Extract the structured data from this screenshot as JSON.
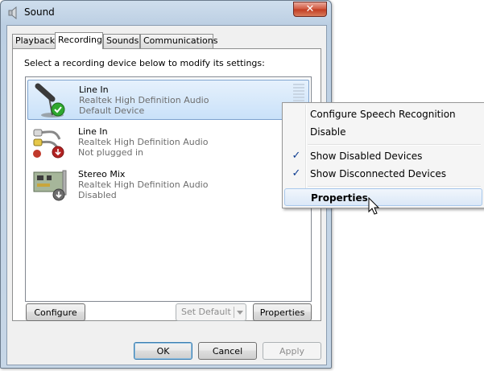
{
  "window": {
    "title": "Sound",
    "close_label": "✕"
  },
  "tabs": [
    {
      "label": "Playback"
    },
    {
      "label": "Recording"
    },
    {
      "label": "Sounds"
    },
    {
      "label": "Communications"
    }
  ],
  "active_tab": "Recording",
  "instruction": "Select a recording device below to modify its settings:",
  "devices": [
    {
      "name": "Line In",
      "driver": "Realtek High Definition Audio",
      "status": "Default Device",
      "icon": "microphone-icon",
      "badge": "green-check-badge"
    },
    {
      "name": "Line In",
      "driver": "Realtek High Definition Audio",
      "status": "Not plugged in",
      "icon": "rca-cable-icon",
      "badge": "red-down-arrow-badge"
    },
    {
      "name": "Stereo Mix",
      "driver": "Realtek High Definition Audio",
      "status": "Disabled",
      "icon": "sound-card-icon",
      "badge": "grey-down-arrow-badge"
    }
  ],
  "buttons": {
    "configure": "Configure",
    "set_default": "Set Default",
    "properties": "Properties",
    "ok": "OK",
    "cancel": "Cancel",
    "apply": "Apply"
  },
  "context_menu": {
    "items": [
      {
        "label": "Configure Speech Recognition",
        "checked": false
      },
      {
        "label": "Disable",
        "checked": false
      },
      {
        "label": "Show Disabled Devices",
        "checked": true
      },
      {
        "label": "Show Disconnected Devices",
        "checked": true
      },
      {
        "label": "Properties",
        "checked": false,
        "default": true,
        "hovered": true
      }
    ],
    "check_glyph": "✓"
  }
}
